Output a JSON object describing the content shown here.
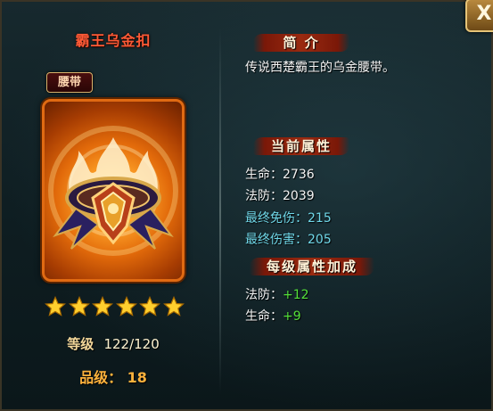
{
  "item": {
    "name": "霸王乌金扣",
    "type_tag": "腰带",
    "stars": 6,
    "level_label": "等级",
    "level_value": "122/120",
    "grade_label": "品级：",
    "grade_value": "18"
  },
  "intro": {
    "header": "简 介",
    "text": "传说西楚霸王的乌金腰带。"
  },
  "current_attrs": {
    "header": "当前属性",
    "lines": [
      {
        "label": "生命：",
        "value": "2736"
      },
      {
        "label": "法防：",
        "value": "2039"
      },
      {
        "label": "最终免伤：",
        "value": "215"
      },
      {
        "label": "最终伤害：",
        "value": "205"
      }
    ]
  },
  "per_level": {
    "header": "每级属性加成",
    "lines": [
      {
        "label": "法防：",
        "value": "+12"
      },
      {
        "label": "生命：",
        "value": "+9"
      }
    ]
  },
  "close_label": "X",
  "colors": {
    "name": "#ff5a36",
    "cyan_text": "#6fd7e8",
    "green_bonus": "#54e03a",
    "card_border": "#e06a12"
  }
}
